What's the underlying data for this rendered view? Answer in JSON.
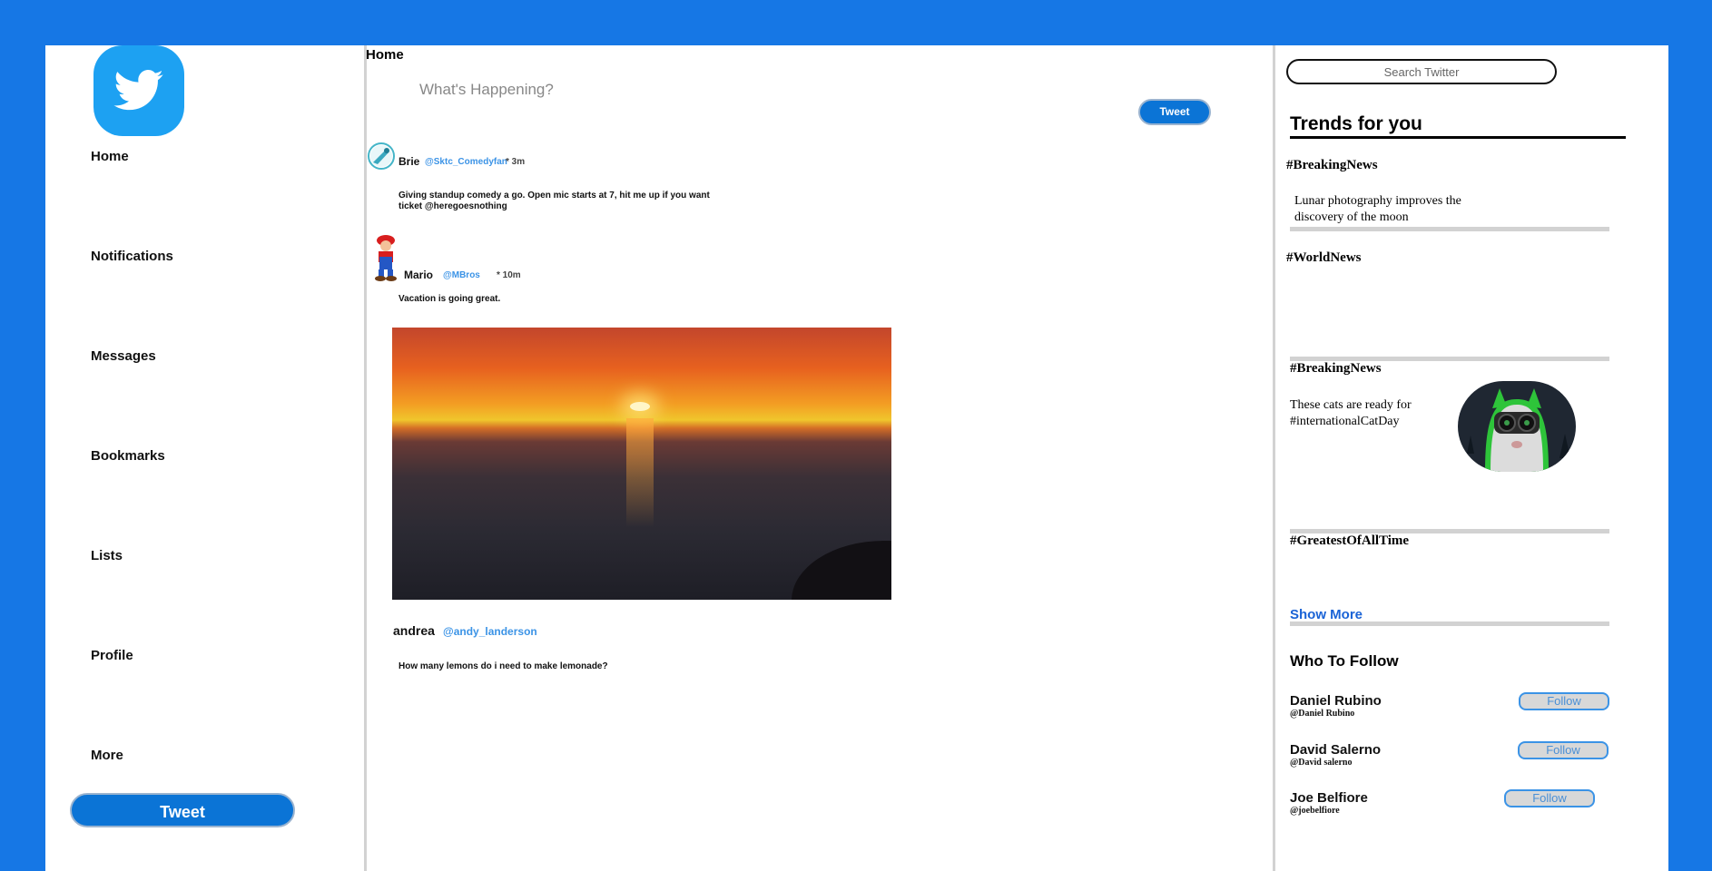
{
  "sidebar": {
    "logo": "twitter-bird-logo",
    "items": [
      {
        "label": "Home"
      },
      {
        "label": "Notifications"
      },
      {
        "label": "Messages"
      },
      {
        "label": "Bookmarks"
      },
      {
        "label": "Lists"
      },
      {
        "label": "Profile"
      },
      {
        "label": "More"
      }
    ],
    "tweet_button": "Tweet"
  },
  "feed": {
    "title": "Home",
    "compose": {
      "placeholder": "What's Happening?",
      "button": "Tweet"
    },
    "tweets": [
      {
        "name": "Brie",
        "handle": "@Sktc_Comedyfan",
        "time": "* 3m",
        "text": "Giving standup comedy a go. Open mic starts at 7, hit me up if you want ticket @heregoesnothing"
      },
      {
        "name": "Mario",
        "handle": "@MBros",
        "time": "* 10m",
        "text": "Vacation is going great."
      },
      {
        "name": "andrea",
        "handle": "@andy_landerson",
        "text": "How many lemons do i need to make lemonade?"
      }
    ]
  },
  "right": {
    "search_placeholder": "Search Twitter",
    "trends_title": "Trends for you",
    "trends": [
      {
        "tag": "#BreakingNews",
        "text": "Lunar photography improves the discovery of the moon"
      },
      {
        "tag": "#WorldNews"
      },
      {
        "tag": "#BreakingNews",
        "text": "These cats are ready for #internationalCatDay"
      },
      {
        "tag": "#GreatestOfAllTime"
      }
    ],
    "show_more": "Show More",
    "who_to_follow_title": "Who To Follow",
    "follow": [
      {
        "name": "Daniel Rubino",
        "handle": "@Daniel Rubino",
        "button": "Follow"
      },
      {
        "name": "David Salerno",
        "handle": "@David salerno",
        "button": "Follow"
      },
      {
        "name": "Joe Belfiore",
        "handle": "@joebelfiore",
        "button": "Follow"
      }
    ]
  },
  "colors": {
    "background": "#1677e5",
    "accent": "#0b74d6",
    "link": "#3b93e6",
    "logo": "#1da1f2"
  }
}
